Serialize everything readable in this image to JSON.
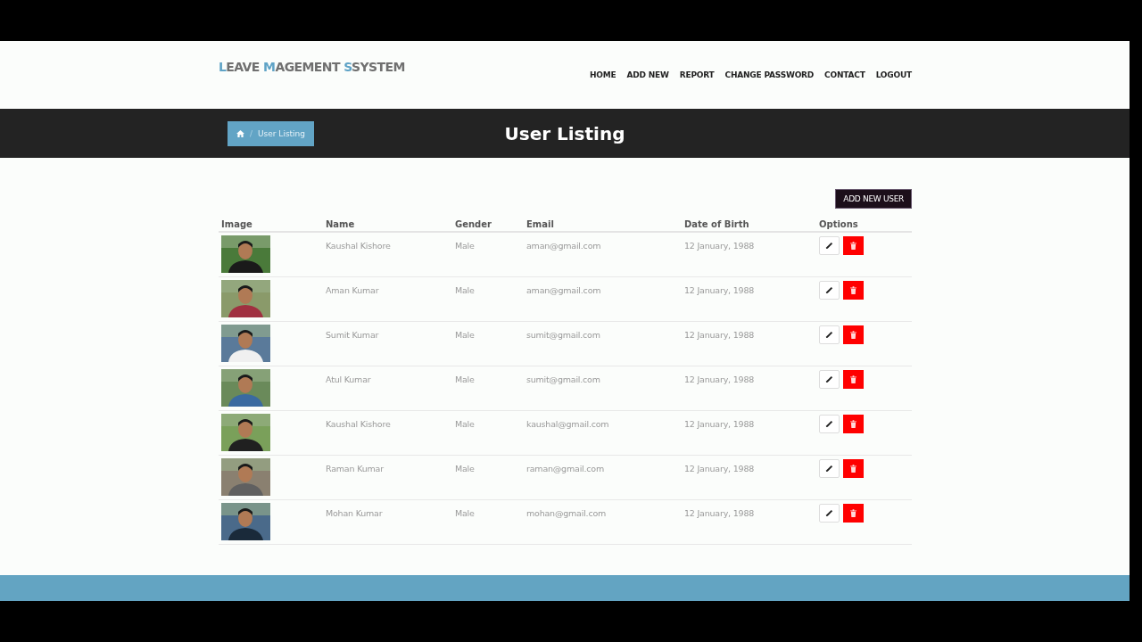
{
  "brand": [
    {
      "text": "L",
      "accent": true
    },
    {
      "text": "EAVE ",
      "accent": false
    },
    {
      "text": "M",
      "accent": true
    },
    {
      "text": "AGEMENT ",
      "accent": false
    },
    {
      "text": "S",
      "accent": true
    },
    {
      "text": "SYSTEM",
      "accent": false
    }
  ],
  "nav": [
    "HOME",
    "ADD NEW",
    "REPORT",
    "CHANGE PASSWORD",
    "CONTACT",
    "LOGOUT"
  ],
  "breadcrumb": {
    "separator": "/",
    "current": "User Listing"
  },
  "page_title": "User Listing",
  "add_button": "ADD NEW USER",
  "table": {
    "columns": [
      "Image",
      "Name",
      "Gender",
      "Email",
      "Date of Birth",
      "Options"
    ],
    "rows": [
      {
        "name": "Kaushal Kishore",
        "gender": "Male",
        "email": "aman@gmail.com",
        "dob": "12 January, 1988"
      },
      {
        "name": "Aman Kumar",
        "gender": "Male",
        "email": "aman@gmail.com",
        "dob": "12 January, 1988"
      },
      {
        "name": "Sumit Kumar",
        "gender": "Male",
        "email": "sumit@gmail.com",
        "dob": "12 January, 1988"
      },
      {
        "name": "Atul Kumar",
        "gender": "Male",
        "email": "sumit@gmail.com",
        "dob": "12 January, 1988"
      },
      {
        "name": "Kaushal Kishore",
        "gender": "Male",
        "email": "kaushal@gmail.com",
        "dob": "12 January, 1988"
      },
      {
        "name": "Raman Kumar",
        "gender": "Male",
        "email": "raman@gmail.com",
        "dob": "12 January, 1988"
      },
      {
        "name": "Mohan Kumar",
        "gender": "Male",
        "email": "mohan@gmail.com",
        "dob": "12 January, 1988"
      }
    ]
  }
}
